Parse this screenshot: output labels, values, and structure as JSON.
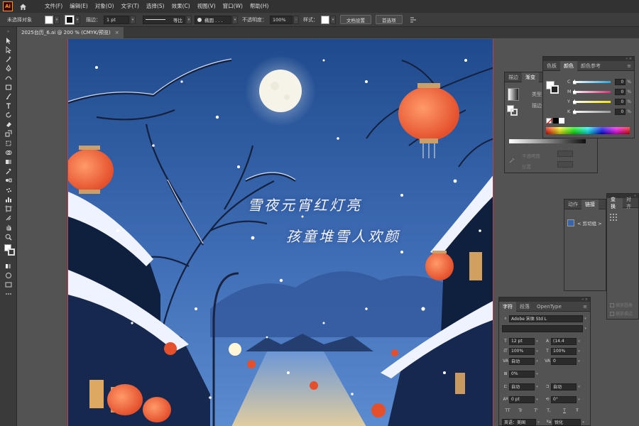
{
  "app": {
    "logo": "Ai"
  },
  "menu": [
    "文件(F)",
    "编辑(E)",
    "对象(O)",
    "文字(T)",
    "选择(S)",
    "效果(C)",
    "视图(V)",
    "窗口(W)",
    "帮助(H)"
  ],
  "control_bar": {
    "selection_label": "未选择对象",
    "stroke_label": "描边：",
    "stroke_weight": "1 pt",
    "stroke_profile": "等比",
    "brush": "椭圆 . . .",
    "opacity_label": "不透明度：",
    "opacity_value": "100%",
    "style_label": "样式：",
    "doc_setup_button": "文档设置",
    "prefs_button": "首选项"
  },
  "document_tab": {
    "title": "2025台历_6.ai @ 200 % (CMYK/预览)"
  },
  "artwork": {
    "poem_line_1": "雪夜元宵红灯亮",
    "poem_line_2": "孩童堆雪人欢颜"
  },
  "color_panel": {
    "tabs": [
      "色板",
      "颜色",
      "颜色参考"
    ],
    "channels": [
      {
        "name": "C",
        "value": "0",
        "color": "#29a8e0"
      },
      {
        "name": "M",
        "value": "0",
        "color": "#e0307a"
      },
      {
        "name": "Y",
        "value": "0",
        "color": "#f3e500"
      },
      {
        "name": "K",
        "value": "0",
        "color": "#9a9a9a"
      }
    ],
    "percent": "%"
  },
  "stroke_panel": {
    "tabs": [
      "描边",
      "渐变"
    ],
    "type_label": "类型",
    "stroke_label": "描边",
    "opacity_label": "不透明度",
    "position_label": "位置"
  },
  "links_panel": {
    "tabs": [
      "动作",
      "链接"
    ],
    "item": "< 剪切组 >"
  },
  "transform_panel": {
    "tabs": [
      "变换",
      "对齐"
    ],
    "options": [
      "缩放圆角",
      "缩放描边"
    ]
  },
  "character_panel": {
    "tabs": [
      "字符",
      "段落",
      "OpenType"
    ],
    "font_family": "Adobe 宋体 Std L",
    "font_style": "",
    "font_size": "12 pt",
    "leading": "(14.4",
    "vertical_scale": "100%",
    "horizontal_scale": "100%",
    "kerning": "自动",
    "tracking": "0",
    "tsume": "0%",
    "aki_left": "自动",
    "aki_right": "自动",
    "baseline_shift": "0 pt",
    "rotation": "0°",
    "text_buttons": [
      "TT",
      "Tr",
      "T'",
      "T,",
      "T",
      "Ŧ"
    ],
    "language": "英语：美国",
    "antialias": "锐化"
  },
  "colors": {
    "menu_bg": "#323232",
    "panel_bg": "#535353",
    "sky_top": "#1f4a8c",
    "sky_bottom": "#4a7bc4",
    "lantern": "#f0683a",
    "moon": "#f6f4e8"
  }
}
